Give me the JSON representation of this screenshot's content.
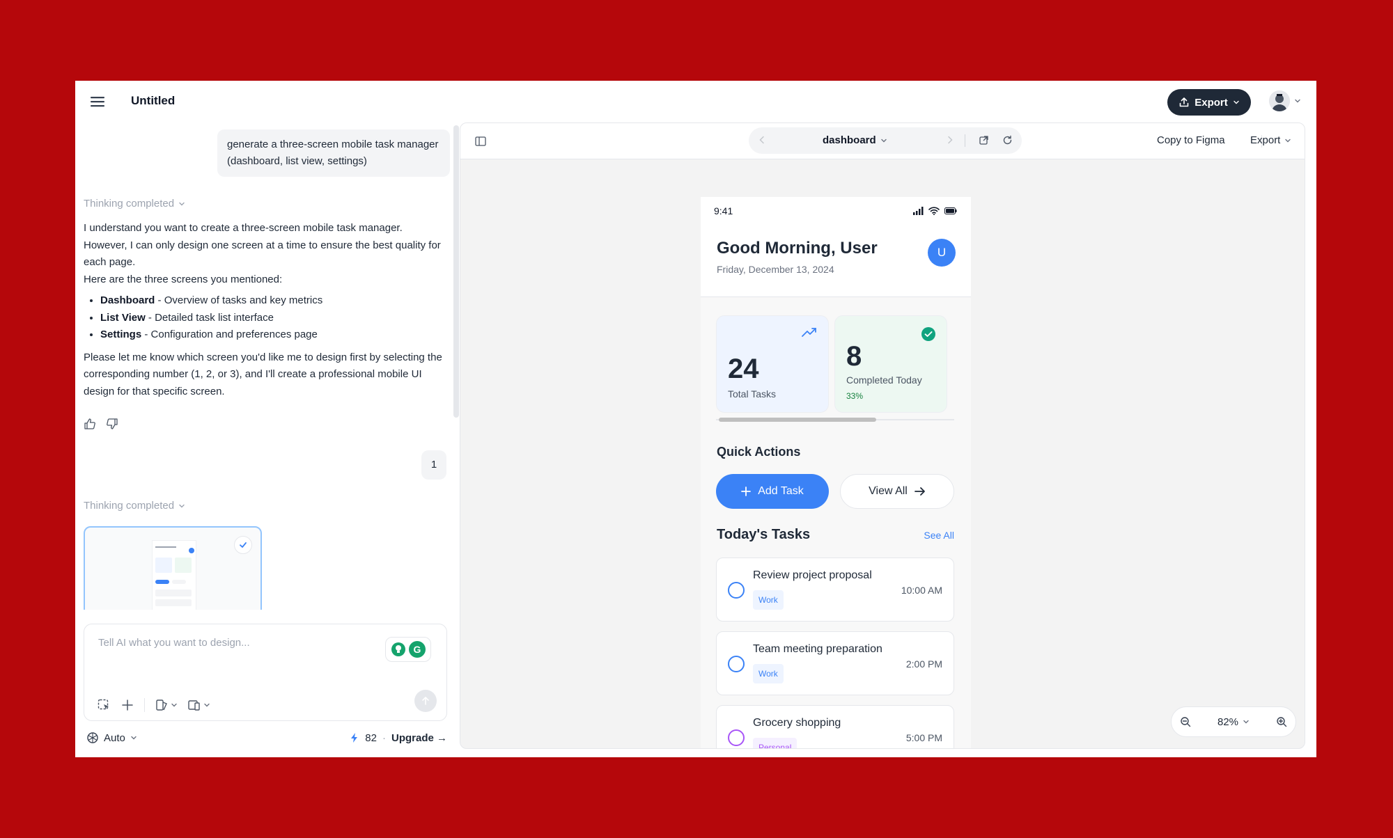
{
  "app": {
    "doc_title": "Untitled",
    "export_label": "Export"
  },
  "chat": {
    "user_prompt": "generate a three-screen mobile task manager (dashboard, list view, settings)",
    "thinking_label": "Thinking completed",
    "ai_intro": "I understand you want to create a three-screen mobile task manager. However, I can only design one screen at a time to ensure the best quality for each page.",
    "ai_lead": "Here are the three screens you mentioned:",
    "screens": [
      {
        "name": "Dashboard",
        "desc": " - Overview of tasks and key metrics"
      },
      {
        "name": "List View",
        "desc": " - Detailed task list interface"
      },
      {
        "name": "Settings",
        "desc": " - Configuration and preferences page"
      }
    ],
    "ai_outro": "Please let me know which screen you'd like me to design first by selecting the corresponding number (1, 2, or 3), and I'll create a professional mobile UI design for that specific screen.",
    "user_reply": "1",
    "composer_placeholder": "Tell AI what you want to design...",
    "model_label": "Auto",
    "credits": "82",
    "upgrade_label": "Upgrade"
  },
  "preview": {
    "page_name": "dashboard",
    "copy_figma_label": "Copy to Figma",
    "export_label": "Export",
    "zoom": "82%"
  },
  "phone": {
    "time": "9:41",
    "greeting": "Good Morning, User",
    "date": "Friday, December 13, 2024",
    "avatar_letter": "U",
    "stats": {
      "total_value": "24",
      "total_label": "Total Tasks",
      "completed_value": "8",
      "completed_label": "Completed Today",
      "completed_pct": "33%"
    },
    "quick_actions_title": "Quick Actions",
    "add_task_label": "Add Task",
    "view_all_label": "View All",
    "todays_tasks_title": "Today's Tasks",
    "see_all_label": "See All",
    "tasks": [
      {
        "title": "Review project proposal",
        "tag": "Work",
        "time": "10:00 AM"
      },
      {
        "title": "Team meeting preparation",
        "tag": "Work",
        "time": "2:00 PM"
      },
      {
        "title": "Grocery shopping",
        "tag": "Personal",
        "time": "5:00 PM"
      }
    ]
  },
  "colors": {
    "background": "#b5070b",
    "accent_blue": "#3b82f6",
    "dark_button": "#1f2937",
    "success_green": "#10a37f",
    "personal_purple": "#a855f7"
  }
}
